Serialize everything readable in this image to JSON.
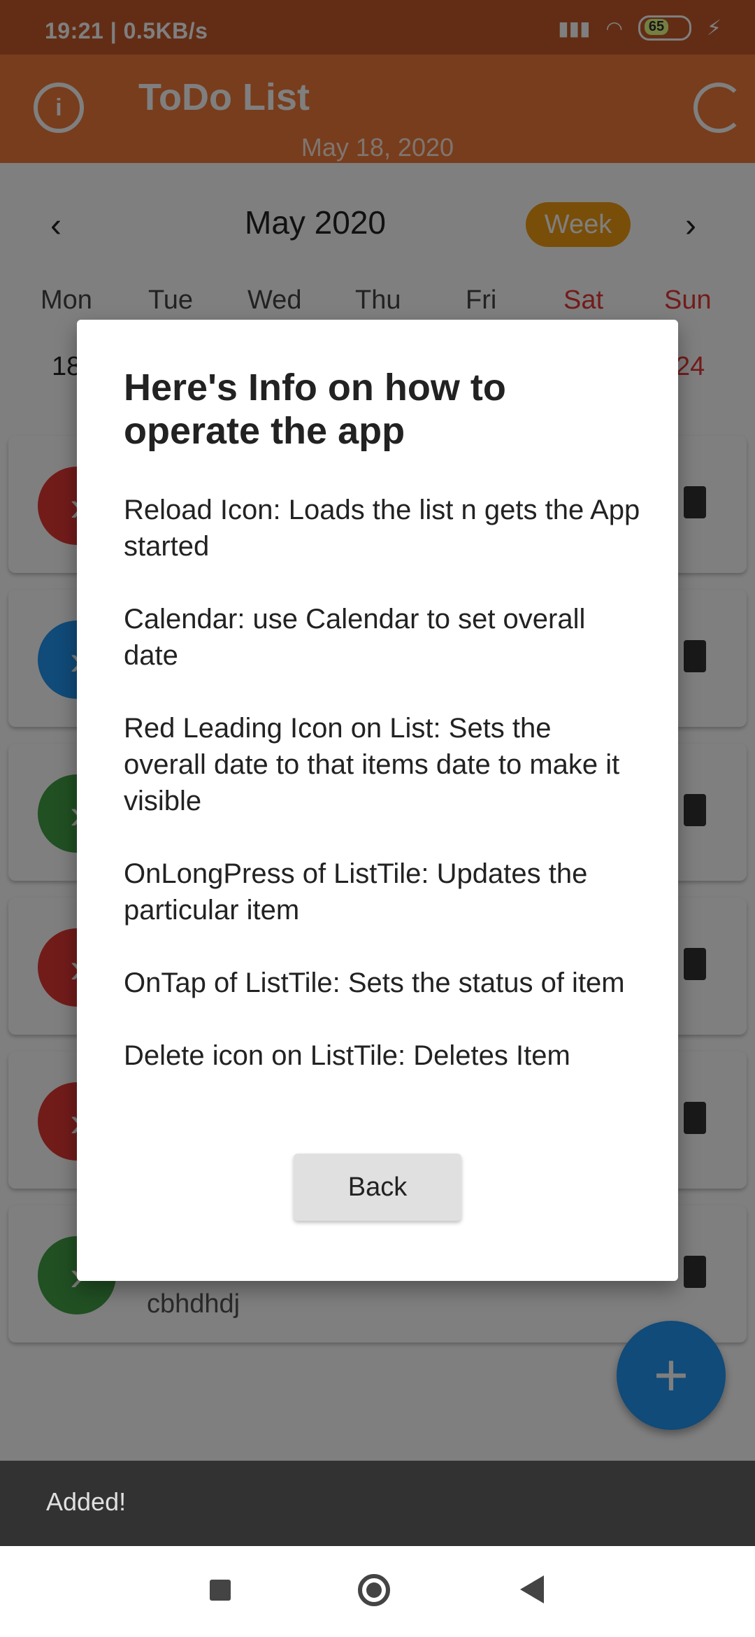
{
  "status_bar": {
    "time_and_speed": "19:21 | 0.5KB/s",
    "battery": "65"
  },
  "app_bar": {
    "title": "ToDo List",
    "date": "May 18, 2020"
  },
  "calendar": {
    "month_label": "May 2020",
    "format_button": "Week",
    "day_names": [
      "Mon",
      "Tue",
      "Wed",
      "Thu",
      "Fri",
      "Sat",
      "Sun"
    ],
    "visible_day_numbers": [
      "18",
      "24"
    ]
  },
  "list_items": [
    {
      "color": "#e53935"
    },
    {
      "color": "#2196f3"
    },
    {
      "color": "#43a047"
    },
    {
      "color": "#e53935"
    },
    {
      "color": "#e53935"
    },
    {
      "color": "#43a047",
      "subtitle": "cbhdhdj"
    }
  ],
  "dialog": {
    "title": "Here's Info on how to operate the app",
    "lines": [
      "Reload Icon: Loads the list n gets the App started",
      "Calendar: use Calendar to set overall date",
      "Red Leading Icon on List: Sets the overall date to that items date to make it visible",
      "OnLongPress of ListTile: Updates the particular item",
      " OnTap of ListTile: Sets the status of item",
      "Delete icon on ListTile: Deletes Item"
    ],
    "back_button": "Back"
  },
  "snackbar": {
    "message": "Added!"
  }
}
